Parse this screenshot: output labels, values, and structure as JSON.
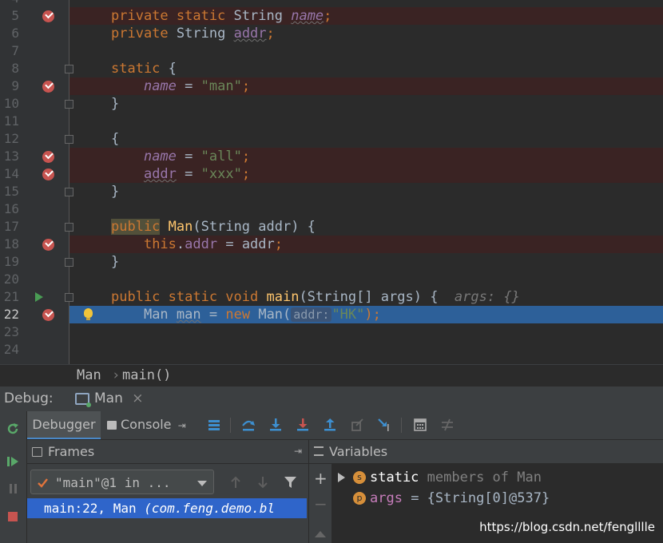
{
  "editor": {
    "partial_top_line": "4",
    "partial_bottom_line": "25",
    "lines": [
      {
        "no": "5",
        "kw1": "private static",
        "type": "String",
        "field": "name",
        "end": ";"
      },
      {
        "no": "6",
        "kw1": "private",
        "type": "String",
        "field": "addr",
        "end": ";"
      },
      {
        "no": "7"
      },
      {
        "no": "8",
        "kw": "static",
        "rest": "{"
      },
      {
        "no": "9",
        "field": "name",
        "op": " = ",
        "str": "\"man\"",
        "end": ";"
      },
      {
        "no": "10",
        "text": "}"
      },
      {
        "no": "11"
      },
      {
        "no": "12",
        "text": "{"
      },
      {
        "no": "13",
        "field": "name",
        "op": " = ",
        "str": "\"all\"",
        "end": ";"
      },
      {
        "no": "14",
        "field": "addr",
        "op": " = ",
        "str": "\"xxx\"",
        "end": ";"
      },
      {
        "no": "15",
        "text": "}"
      },
      {
        "no": "16"
      },
      {
        "no": "17",
        "kw": "public",
        "fn": "Man",
        "rest": "(String addr) {"
      },
      {
        "no": "18",
        "kw": "this",
        "dot": ".",
        "field": "addr",
        "rest": " = addr",
        "end": ";"
      },
      {
        "no": "19",
        "text": "}"
      },
      {
        "no": "20"
      },
      {
        "no": "21",
        "kw": "public static void",
        "fn": "main",
        "rest": "(String[] args) {",
        "hint": "args: {}"
      },
      {
        "no": "22",
        "type": "Man",
        "var": "man",
        "op": " = ",
        "kw": "new",
        "call": "Man(",
        "param_hint": "addr:",
        "str": "\"HK\"",
        "end": ");"
      },
      {
        "no": "23"
      },
      {
        "no": "24"
      }
    ]
  },
  "breadcrumb": {
    "class": "Man",
    "sep": "›",
    "method": "main()"
  },
  "debug_header": {
    "label": "Debug:",
    "tab": "Man",
    "close": "×"
  },
  "toolbar": {
    "debugger_tab": "Debugger",
    "console_tab": "Console",
    "console_pin": "⇥"
  },
  "frames": {
    "title": "Frames",
    "pin": "⇥",
    "thread": "\"main\"@1 in ...",
    "frame": "main:22, Man ",
    "frame_package": "(com.feng.demo.bl"
  },
  "variables": {
    "title": "Variables",
    "rows": [
      {
        "badge": "s",
        "name": "static",
        "value": "members of Man",
        "badge_color": "#d68f3a"
      },
      {
        "badge": "p",
        "name": "args",
        "value": "= {String[0]@537}",
        "badge_color": "#d68f3a"
      }
    ],
    "plus": "+",
    "minus": "−"
  },
  "watermark": "https://blog.csdn.net/fenglllle",
  "colors": {
    "bg": "#2b2b2b",
    "panel": "#3c3f41",
    "selection": "#2d6099",
    "breakpoint": "#c75450",
    "keyword": "#cc7832",
    "string": "#6a8759",
    "field": "#9876aa",
    "method": "#ffc66d"
  }
}
